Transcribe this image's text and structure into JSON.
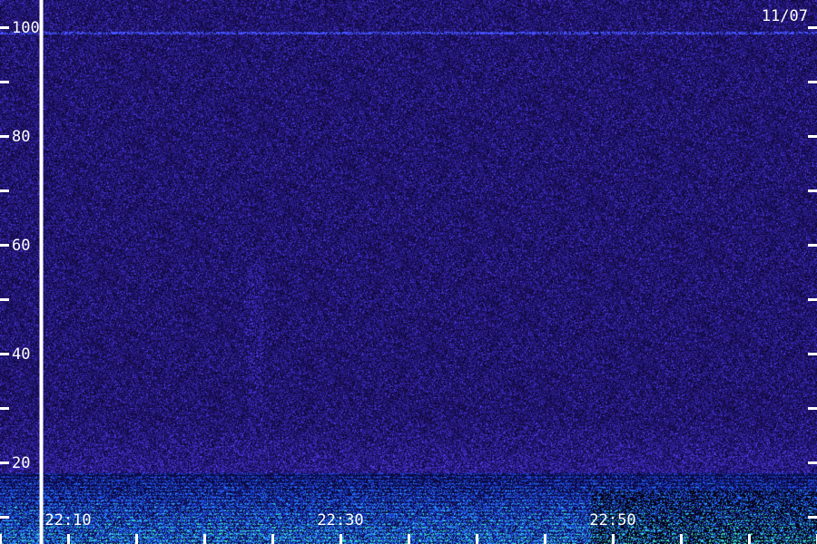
{
  "chart_data": {
    "type": "heatmap",
    "date_label": "11/07",
    "y_axis": {
      "range": [
        0,
        100
      ],
      "labeled_ticks": [
        20,
        40,
        60,
        80,
        100
      ],
      "tick_labels": [
        "20",
        "40",
        "60",
        "80",
        "100"
      ],
      "minor_ticks": [
        10,
        30,
        50,
        70,
        90
      ]
    },
    "x_axis": {
      "range": [
        "22:05",
        "23:05"
      ],
      "tick_labels": [
        "22:10",
        "22:30",
        "22:50"
      ],
      "minor_ticks": [
        "22:05",
        "22:10",
        "22:15",
        "22:20",
        "22:25",
        "22:30",
        "22:35",
        "22:40",
        "22:45",
        "22:50",
        "22:55",
        "23:00",
        "23:05"
      ]
    },
    "marker_line_time": "22:08",
    "horizontal_line_value": 99,
    "colors": {
      "background": "#1a0f4f",
      "noise_dark": "#0c0830",
      "noise_mid": "#2a1c8a",
      "noise_bright": "#4a3ae0",
      "low_band": "#2a6cff",
      "low_band_hot": "#3cf0c0",
      "marker": "#ffffff"
    },
    "grid": false
  }
}
